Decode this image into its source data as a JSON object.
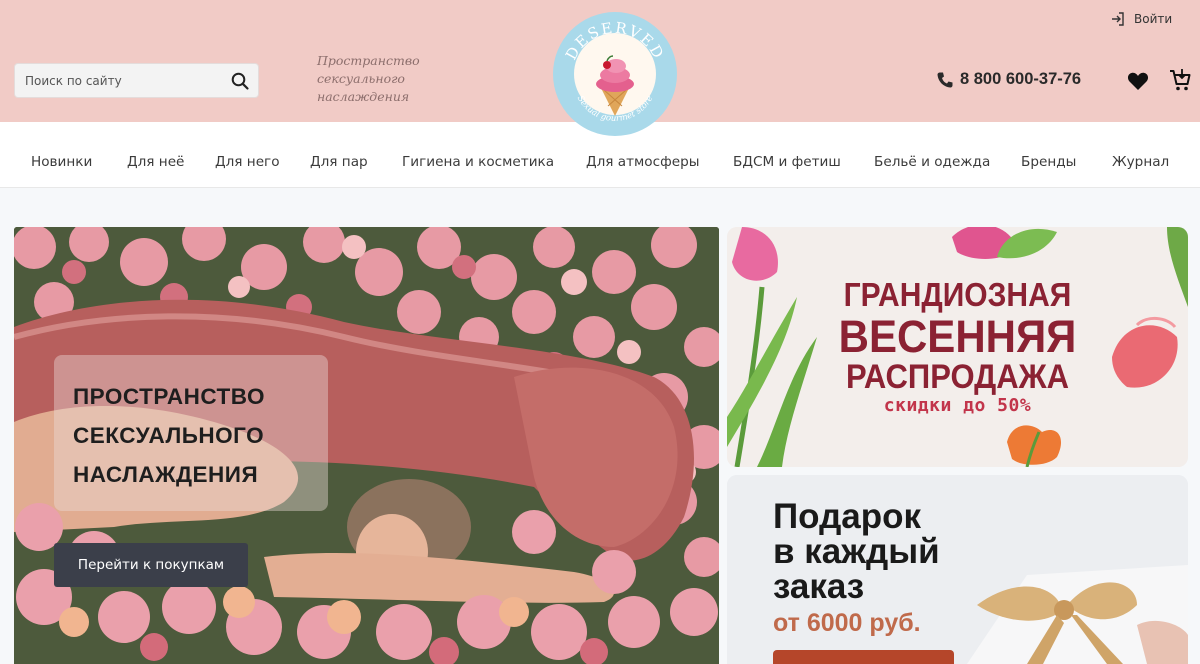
{
  "header": {
    "search": {
      "placeholder": "Поиск по сайту"
    },
    "tagline": [
      "Пространство",
      "сексуального",
      "наслаждения"
    ],
    "logo": {
      "brand": "DESERVED",
      "subtitle": "Sexual gourmet store"
    },
    "login_label": "Войти",
    "phone": "8 800 600-37-76",
    "icons": {
      "search": "search-icon",
      "login": "login-icon",
      "phone": "phone-icon",
      "favorites": "heart-icon",
      "cart": "cart-icon"
    }
  },
  "nav": {
    "items": [
      {
        "label": "Новинки"
      },
      {
        "label": "Для неё"
      },
      {
        "label": "Для него"
      },
      {
        "label": "Для пар"
      },
      {
        "label": "Гигиена и косметика"
      },
      {
        "label": "Для атмосферы"
      },
      {
        "label": "БДСМ и фетиш"
      },
      {
        "label": "Бельё и одежда"
      },
      {
        "label": "Бренды"
      },
      {
        "label": "Журнал"
      }
    ]
  },
  "hero": {
    "title_lines": [
      "ПРОСТРАНСТВО",
      "СЕКСУАЛЬНОГО",
      "НАСЛАЖДЕНИЯ"
    ],
    "cta_label": "Перейти к покупкам"
  },
  "promo_sale": {
    "line1": "ГРАНДИОЗНАЯ",
    "line2": "ВЕСЕННЯЯ",
    "line3": "РАСПРОДАЖА",
    "line4": "скидки до 50%"
  },
  "promo_gift": {
    "title_lines": [
      "Подарок",
      "в каждый",
      "заказ"
    ],
    "subtitle": "от 6000 руб."
  },
  "colors": {
    "header_bg": "#f1cbc6",
    "accent_dark": "#3b3f4a",
    "sale_red": "#8b2233",
    "gift_orange": "#c06a4b"
  }
}
